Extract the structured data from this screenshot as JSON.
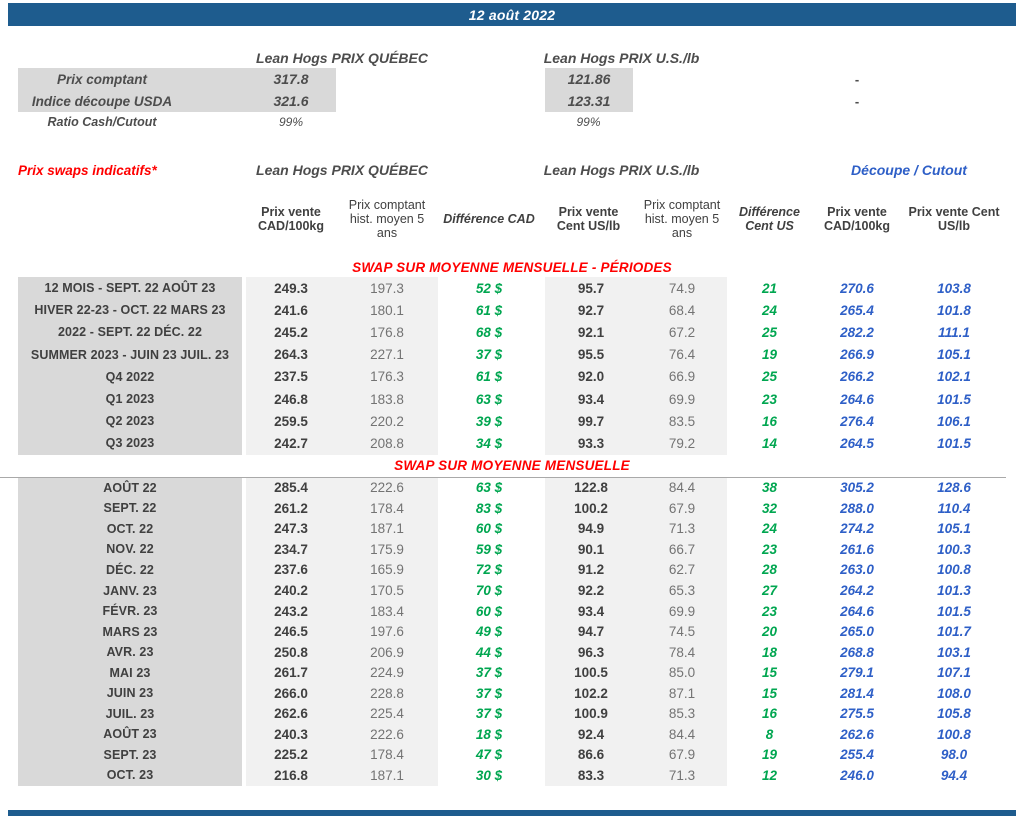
{
  "titlebar": {
    "date": "12 août 2022"
  },
  "summary": {
    "qc_header": "Lean Hogs PRIX QUÉBEC",
    "us_header": "Lean Hogs PRIX U.S./lb",
    "rows": [
      {
        "label": "Prix comptant",
        "qc": "317.8",
        "us": "121.86",
        "dash": "-"
      },
      {
        "label": "Indice découpe USDA",
        "qc": "321.6",
        "us": "123.31",
        "dash": "-"
      }
    ],
    "ratio_row": {
      "label": "Ratio Cash/Cutout",
      "qc": "99%",
      "us": "99%"
    }
  },
  "swaps": {
    "title": "Prix swaps indicatifs*",
    "qc_header": "Lean Hogs PRIX QUÉBEC",
    "us_header": "Lean Hogs PRIX U.S./lb",
    "cutout_header": "Découpe / Cutout",
    "columns": [
      "Prix vente CAD/100kg",
      "Prix comptant hist. moyen 5 ans",
      "Différence CAD",
      "Prix vente Cent US/lb",
      "Prix comptant hist. moyen 5 ans",
      "Différence Cent US",
      "Prix vente CAD/100kg",
      "Prix vente Cent US/lb"
    ],
    "sections": [
      {
        "title": "SWAP SUR MOYENNE MENSUELLE - PÉRIODES",
        "rows": [
          {
            "label": "12 MOIS - SEPT. 22 AOÛT 23",
            "values": [
              "249.3",
              "197.3",
              "52 $",
              "95.7",
              "74.9",
              "21",
              "270.6",
              "103.8"
            ]
          },
          {
            "label": "HIVER 22-23 - OCT. 22 MARS 23",
            "values": [
              "241.6",
              "180.1",
              "61 $",
              "92.7",
              "68.4",
              "24",
              "265.4",
              "101.8"
            ]
          },
          {
            "label": "2022 - SEPT. 22 DÉC. 22",
            "values": [
              "245.2",
              "176.8",
              "68 $",
              "92.1",
              "67.2",
              "25",
              "282.2",
              "111.1"
            ]
          },
          {
            "label": "SUMMER 2023 - JUIN 23 JUIL. 23",
            "values": [
              "264.3",
              "227.1",
              "37 $",
              "95.5",
              "76.4",
              "19",
              "266.9",
              "105.1"
            ]
          },
          {
            "label": "Q4 2022",
            "values": [
              "237.5",
              "176.3",
              "61 $",
              "92.0",
              "66.9",
              "25",
              "266.2",
              "102.1"
            ]
          },
          {
            "label": "Q1 2023",
            "values": [
              "246.8",
              "183.8",
              "63 $",
              "93.4",
              "69.9",
              "23",
              "264.6",
              "101.5"
            ]
          },
          {
            "label": "Q2 2023",
            "values": [
              "259.5",
              "220.2",
              "39 $",
              "99.7",
              "83.5",
              "16",
              "276.4",
              "106.1"
            ]
          },
          {
            "label": "Q3 2023",
            "values": [
              "242.7",
              "208.8",
              "34 $",
              "93.3",
              "79.2",
              "14",
              "264.5",
              "101.5"
            ]
          }
        ]
      },
      {
        "title": "SWAP SUR MOYENNE MENSUELLE",
        "rows": [
          {
            "label": "AOÛT 22",
            "values": [
              "285.4",
              "222.6",
              "63 $",
              "122.8",
              "84.4",
              "38",
              "305.2",
              "128.6"
            ]
          },
          {
            "label": "SEPT. 22",
            "values": [
              "261.2",
              "178.4",
              "83 $",
              "100.2",
              "67.9",
              "32",
              "288.0",
              "110.4"
            ]
          },
          {
            "label": "OCT. 22",
            "values": [
              "247.3",
              "187.1",
              "60 $",
              "94.9",
              "71.3",
              "24",
              "274.2",
              "105.1"
            ]
          },
          {
            "label": "NOV. 22",
            "values": [
              "234.7",
              "175.9",
              "59 $",
              "90.1",
              "66.7",
              "23",
              "261.6",
              "100.3"
            ]
          },
          {
            "label": "DÉC. 22",
            "values": [
              "237.6",
              "165.9",
              "72 $",
              "91.2",
              "62.7",
              "28",
              "263.0",
              "100.8"
            ]
          },
          {
            "label": "JANV. 23",
            "values": [
              "240.2",
              "170.5",
              "70 $",
              "92.2",
              "65.3",
              "27",
              "264.2",
              "101.3"
            ]
          },
          {
            "label": "FÉVR. 23",
            "values": [
              "243.2",
              "183.4",
              "60 $",
              "93.4",
              "69.9",
              "23",
              "264.6",
              "101.5"
            ]
          },
          {
            "label": "MARS 23",
            "values": [
              "246.5",
              "197.6",
              "49 $",
              "94.7",
              "74.5",
              "20",
              "265.0",
              "101.7"
            ]
          },
          {
            "label": "AVR. 23",
            "values": [
              "250.8",
              "206.9",
              "44 $",
              "96.3",
              "78.4",
              "18",
              "268.8",
              "103.1"
            ]
          },
          {
            "label": "MAI 23",
            "values": [
              "261.7",
              "224.9",
              "37 $",
              "100.5",
              "85.0",
              "15",
              "279.1",
              "107.1"
            ]
          },
          {
            "label": "JUIN 23",
            "values": [
              "266.0",
              "228.8",
              "37 $",
              "102.2",
              "87.1",
              "15",
              "281.4",
              "108.0"
            ]
          },
          {
            "label": "JUIL. 23",
            "values": [
              "262.6",
              "225.4",
              "37 $",
              "100.9",
              "85.3",
              "16",
              "275.5",
              "105.8"
            ]
          },
          {
            "label": "AOÛT 23",
            "values": [
              "240.3",
              "222.6",
              "18 $",
              "92.4",
              "84.4",
              "8",
              "262.6",
              "100.8"
            ]
          },
          {
            "label": "SEPT. 23",
            "values": [
              "225.2",
              "178.4",
              "47 $",
              "86.6",
              "67.9",
              "19",
              "255.4",
              "98.0"
            ]
          },
          {
            "label": "OCT. 23",
            "values": [
              "216.8",
              "187.1",
              "30 $",
              "83.3",
              "71.3",
              "12",
              "246.0",
              "94.4"
            ]
          }
        ]
      }
    ]
  }
}
